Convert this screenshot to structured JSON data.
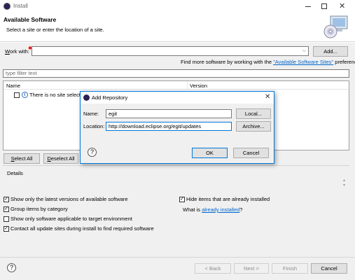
{
  "window": {
    "title": "Install",
    "minimize_icon": "minimize-icon",
    "maximize_icon": "maximize-icon",
    "close_icon": "close-icon"
  },
  "header": {
    "title": "Available Software",
    "subtitle": "Select a site or enter the location of a site."
  },
  "work_with": {
    "label_pre": "W",
    "label_post": "ork with:",
    "value": "",
    "add_button": "Add...",
    "find_more_pre": "Find more software by working with the ",
    "find_more_link": "\"Available Software Sites\"",
    "find_more_post": " preferences."
  },
  "filter": {
    "placeholder": "type filter text"
  },
  "table": {
    "columns": [
      "Name",
      "Version"
    ],
    "empty_message": "There is no site selected."
  },
  "selection_buttons": {
    "select_all": "Select All",
    "deselect_all": "Deselect All"
  },
  "details": {
    "label": "Details"
  },
  "options": {
    "latest_versions": {
      "label": "Show only the latest versions of available software",
      "checked": true
    },
    "group_by_category": {
      "label": "Group items by category",
      "checked": true
    },
    "applicable_only": {
      "label": "Show only software applicable to target environment",
      "checked": false
    },
    "contact_sites": {
      "label": "Contact all update sites during install to find required software",
      "checked": true
    },
    "hide_installed": {
      "label": "Hide items that are already installed",
      "checked": true
    },
    "what_is_pre": "What is ",
    "what_is_link": "already installed",
    "what_is_post": "?"
  },
  "footer": {
    "back": "< Back",
    "next": "Next >",
    "finish": "Finish",
    "cancel": "Cancel"
  },
  "dialog": {
    "title": "Add Repository",
    "name_label": "Name:",
    "name_value": "egit",
    "local_button": "Local...",
    "location_label": "Location:",
    "location_value": "http://download.eclipse.org/egit/updates",
    "archive_button": "Archive...",
    "ok_button": "OK",
    "cancel_button": "Cancel"
  },
  "colors": {
    "link": "#0066cc",
    "focus_border": "#0078d7",
    "dialog_border": "#0078d7"
  }
}
